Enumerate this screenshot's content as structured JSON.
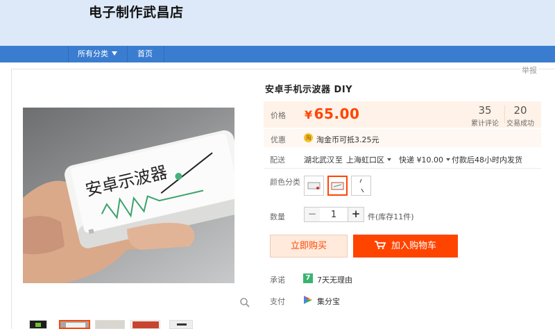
{
  "shop": {
    "name": "电子制作武昌店"
  },
  "nav": {
    "all_categories": "所有分类",
    "home": "首页"
  },
  "report": "举报",
  "product": {
    "title": "安卓手机示波器 DIY",
    "image_text": "安卓示波器",
    "price_label": "价格",
    "currency": "¥",
    "price": "65.00",
    "reviews_count": "35",
    "reviews_label": "累计评论",
    "sales_count": "20",
    "sales_label": "交易成功"
  },
  "promo": {
    "label": "优惠",
    "icon": "淘",
    "text": "淘金币可抵3.25元"
  },
  "shipping": {
    "label": "配送",
    "from": "湖北武汉",
    "to_word": "至",
    "to": "上海虹口区",
    "method": "快递 ¥10.00",
    "time": "付款后48小时内发货"
  },
  "color": {
    "label": "颜色分类",
    "selected_index": 1
  },
  "quantity": {
    "label": "数量",
    "minus": "−",
    "plus": "+",
    "value": "1",
    "stock": "件(库存11件)"
  },
  "actions": {
    "buy_now": "立即购买",
    "add_to_cart": "加入购物车"
  },
  "promise": {
    "label": "承诺",
    "badge": "7",
    "text": "7天无理由"
  },
  "payment": {
    "label": "支付",
    "text": "集分宝"
  },
  "colors": {
    "accent": "#ff4400",
    "nav": "#3a7dd0",
    "header_bg": "#dde9f8",
    "price_bg": "#fff2e8",
    "badge_green": "#3cb371"
  }
}
